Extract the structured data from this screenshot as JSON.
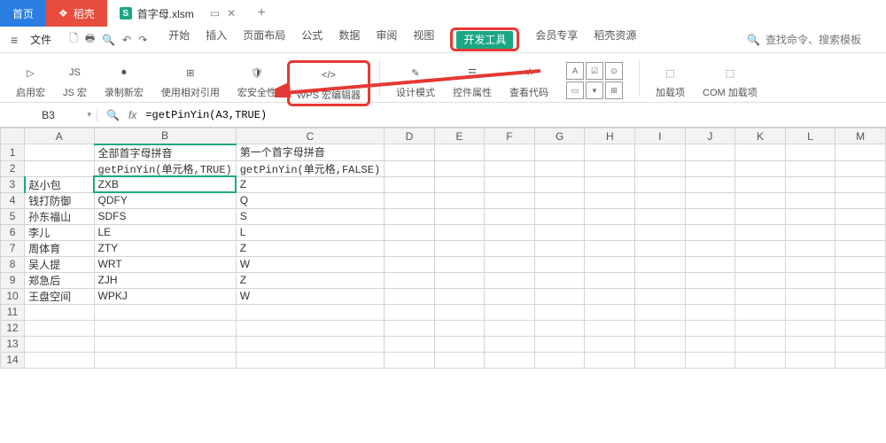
{
  "tabs": {
    "home": "首页",
    "ks": "稻壳",
    "file": "首字母.xlsm"
  },
  "menubar": {
    "file": "文件",
    "items": [
      "开始",
      "插入",
      "页面布局",
      "公式",
      "数据",
      "审阅",
      "视图",
      "开发工具",
      "会员专享",
      "稻壳资源"
    ],
    "active_index": 7,
    "search_placeholder": "查找命令、搜索模板"
  },
  "ribbon": {
    "b0": "启用宏",
    "b1": "JS 宏",
    "b2": "录制新宏",
    "b3": "使用相对引用",
    "b4": "宏安全性",
    "b5": "WPS 宏编辑器",
    "b6": "设计模式",
    "b7": "控件属性",
    "b8": "查看代码",
    "b9": "加载项",
    "b10": "COM 加载项"
  },
  "formula_bar": {
    "name_box": "B3",
    "formula": "=getPinYin(A3,TRUE)"
  },
  "columns": [
    "A",
    "B",
    "C",
    "D",
    "E",
    "F",
    "G",
    "H",
    "I",
    "J",
    "K",
    "L",
    "M"
  ],
  "rows": [
    {
      "n": "1",
      "A": "",
      "B": "全部首字母拼音",
      "C": "第一个首字母拼音"
    },
    {
      "n": "2",
      "A": "",
      "B": "getPinYin(单元格,TRUE)",
      "C": "getPinYin(单元格,FALSE)"
    },
    {
      "n": "3",
      "A": "赵小包",
      "B": "ZXB",
      "C": "Z"
    },
    {
      "n": "4",
      "A": "钱打防御",
      "B": "QDFY",
      "C": "Q"
    },
    {
      "n": "5",
      "A": "孙东福山",
      "B": "SDFS",
      "C": "S"
    },
    {
      "n": "6",
      "A": "李儿",
      "B": "LE",
      "C": "L"
    },
    {
      "n": "7",
      "A": "周体育",
      "B": "ZTY",
      "C": "Z"
    },
    {
      "n": "8",
      "A": "吴人提",
      "B": "WRT",
      "C": "W"
    },
    {
      "n": "9",
      "A": "郑急后",
      "B": "ZJH",
      "C": "Z"
    },
    {
      "n": "10",
      "A": "王盘空间",
      "B": "WPKJ",
      "C": "W"
    },
    {
      "n": "11",
      "A": "",
      "B": "",
      "C": ""
    },
    {
      "n": "12",
      "A": "",
      "B": "",
      "C": ""
    },
    {
      "n": "13",
      "A": "",
      "B": "",
      "C": ""
    },
    {
      "n": "14",
      "A": "",
      "B": "",
      "C": ""
    }
  ],
  "selected": {
    "col": "B",
    "row": "3"
  }
}
